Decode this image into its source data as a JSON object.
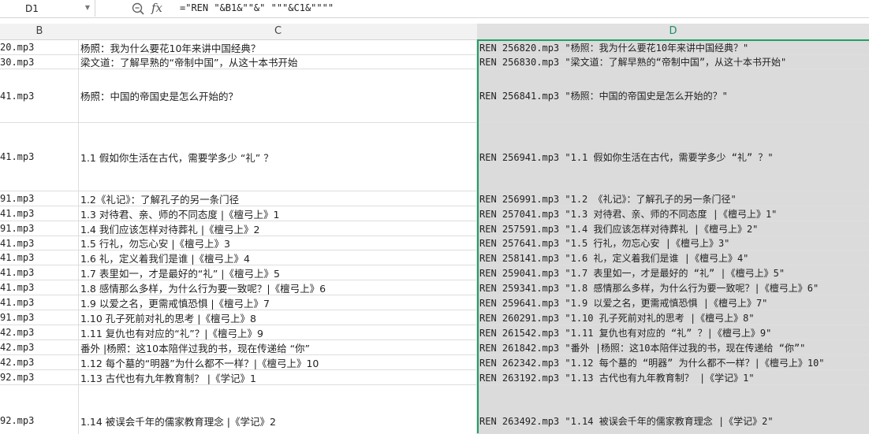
{
  "formula_bar": {
    "name_box": "D1",
    "fx_label": "fx",
    "formula": "=\"REN \"&B1&\"\"&\" \"\"\"&C1&\"\"\"\""
  },
  "columns": [
    {
      "letter": "B"
    },
    {
      "letter": "C"
    },
    {
      "letter": "D"
    }
  ],
  "rows": [
    {
      "b": "20.mp3",
      "c": "杨照：我为什么要花10年来讲中国经典？",
      "d": "REN 256820.mp3 \"杨照：我为什么要花10年来讲中国经典？\""
    },
    {
      "b": "30.mp3",
      "c": "梁文道：了解早熟的“帝制中国”，从这十本书开始",
      "d": "REN 256830.mp3 \"梁文道：了解早熟的“帝制中国”，从这十本书开始\""
    },
    {
      "b": "41.mp3",
      "c": "杨照：中国的帝国史是怎么开始的？",
      "d": "REN 256841.mp3 \"杨照：中国的帝国史是怎么开始的？\""
    },
    {
      "b": "41.mp3",
      "c": "1.1 假如你生活在古代，需要学多少 “礼” ？",
      "d": "REN 256941.mp3 \"1.1 假如你生活在古代，需要学多少 “礼” ？\""
    },
    {
      "b": "91.mp3",
      "c": "1.2《礼记》：了解孔子的另一条门径",
      "d": "REN 256991.mp3 \"1.2 《礼记》：了解孔子的另一条门径\""
    },
    {
      "b": "41.mp3",
      "c": "1.3 对待君、亲、师的不同态度 |《檀弓上》1",
      "d": "REN 257041.mp3 \"1.3 对待君、亲、师的不同态度 |《檀弓上》1\""
    },
    {
      "b": "91.mp3",
      "c": "1.4 我们应该怎样对待葬礼 |《檀弓上》2",
      "d": "REN 257591.mp3 \"1.4 我们应该怎样对待葬礼 |《檀弓上》2\""
    },
    {
      "b": "41.mp3",
      "c": "1.5 行礼，勿忘心安 |《檀弓上》3",
      "d": "REN 257641.mp3 \"1.5 行礼，勿忘心安 |《檀弓上》3\""
    },
    {
      "b": "41.mp3",
      "c": "1.6 礼，定义着我们是谁 |《檀弓上》4",
      "d": "REN 258141.mp3 \"1.6 礼，定义着我们是谁 |《檀弓上》4\""
    },
    {
      "b": "41.mp3",
      "c": "1.7 表里如一，才是最好的“礼” |《檀弓上》5",
      "d": "REN 259041.mp3 \"1.7 表里如一，才是最好的 “礼” |《檀弓上》5\""
    },
    {
      "b": "41.mp3",
      "c": "1.8 感情那么多样，为什么行为要一致呢？|《檀弓上》6",
      "d": "REN 259341.mp3 \"1.8 感情那么多样，为什么行为要一致呢？|《檀弓上》6\""
    },
    {
      "b": "41.mp3",
      "c": "1.9 以爱之名，更需戒慎恐惧 |《檀弓上》7",
      "d": "REN 259641.mp3 \"1.9 以爱之名，更需戒慎恐惧 |《檀弓上》7\""
    },
    {
      "b": "91.mp3",
      "c": "1.10 孔子死前对礼的思考 |《檀弓上》8",
      "d": "REN 260291.mp3 \"1.10 孔子死前对礼的思考 |《檀弓上》8\""
    },
    {
      "b": "42.mp3",
      "c": "1.11 复仇也有对应的“礼”？|《檀弓上》9",
      "d": "REN 261542.mp3 \"1.11 复仇也有对应的 “礼” ？|《檀弓上》9\""
    },
    {
      "b": "42.mp3",
      "c": "番外 |杨照：这10本陪伴过我的书，现在传递给 “你”",
      "d": "REN 261842.mp3 \"番外 |杨照：这10本陪伴过我的书，现在传递给 “你”\""
    },
    {
      "b": "42.mp3",
      "c": "1.12 每个墓的“明器”为什么都不一样？|《檀弓上》10",
      "d": "REN 262342.mp3 \"1.12 每个墓的 “明器” 为什么都不一样？|《檀弓上》10\""
    },
    {
      "b": "92.mp3",
      "c": "1.13 古代也有九年教育制？ |《学记》1",
      "d": "REN 263192.mp3 \"1.13 古代也有九年教育制？ |《学记》1\""
    },
    {
      "b": "92.mp3",
      "c": "1.14 被误会千年的儒家教育理念 |《学记》2",
      "d": "REN 263492.mp3 \"1.14 被误会千年的儒家教育理念 |《学记》2\""
    }
  ]
}
